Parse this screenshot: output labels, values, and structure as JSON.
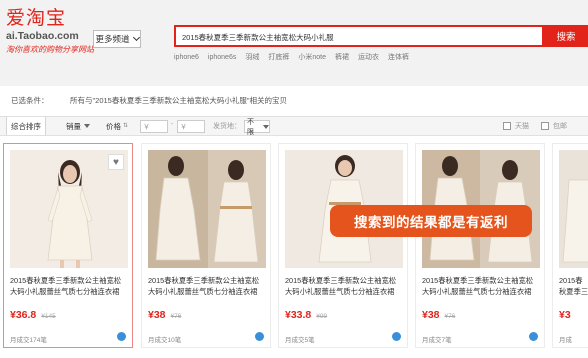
{
  "logo": {
    "main": "爱淘宝",
    "url": "ai.Taobao.com",
    "slogan": "淘你喜欢的购物分享网站"
  },
  "header": {
    "channel_label": "更多频道",
    "search_query": "2015春秋夏季三季新款公主袖宽松大码小礼服",
    "search_button": "搜索",
    "hotwords": [
      "iphone6",
      "iphone6s",
      "羽绒",
      "打底裤",
      "小米note",
      "裤裙",
      "运动衣",
      "连体裤"
    ]
  },
  "filter": {
    "label": "已选条件：",
    "text": "所有与\"2015春秋夏季三季新款公主袖宽松大码小礼服\"相关的宝贝"
  },
  "sortbar": {
    "sort": "综合排序",
    "sales": "销量",
    "price": "价格",
    "price_from": "￥",
    "price_to": "￥",
    "dash": "-",
    "ship_from": "发货地：",
    "ship_value": "不限",
    "cat": "天猫",
    "return": "包邮"
  },
  "products": [
    {
      "title": "2015春秋夏季三季新款公主袖宽松大码小礼服蕾丝气质七分袖连衣裙",
      "price": "¥36.8",
      "original_price": "¥145",
      "sales": "月成交174笔"
    },
    {
      "title": "2015春秋夏季三季新款公主袖宽松大码小礼服蕾丝气质七分袖连衣裙",
      "price": "¥38",
      "original_price": "¥76",
      "sales": "月成交10笔"
    },
    {
      "title": "2015春秋夏季三季新款公主袖宽松大码小礼服蕾丝气质七分袖连衣裙",
      "price": "¥33.8",
      "original_price": "¥99",
      "sales": "月成交5笔"
    },
    {
      "title": "2015春秋夏季三季新款公主袖宽松大码小礼服蕾丝气质七分袖连衣裙",
      "price": "¥38",
      "original_price": "¥76",
      "sales": "月成交7笔"
    },
    {
      "title": "2015春秋夏季三季新款公主袖宽松大码小礼服蕾丝",
      "price": "¥3",
      "original_price": "",
      "sales": "月成"
    }
  ],
  "overlay_text": "搜索到的结果都是有返利",
  "colors": {
    "accent": "#e2231a",
    "overlay": "#e4541c"
  }
}
